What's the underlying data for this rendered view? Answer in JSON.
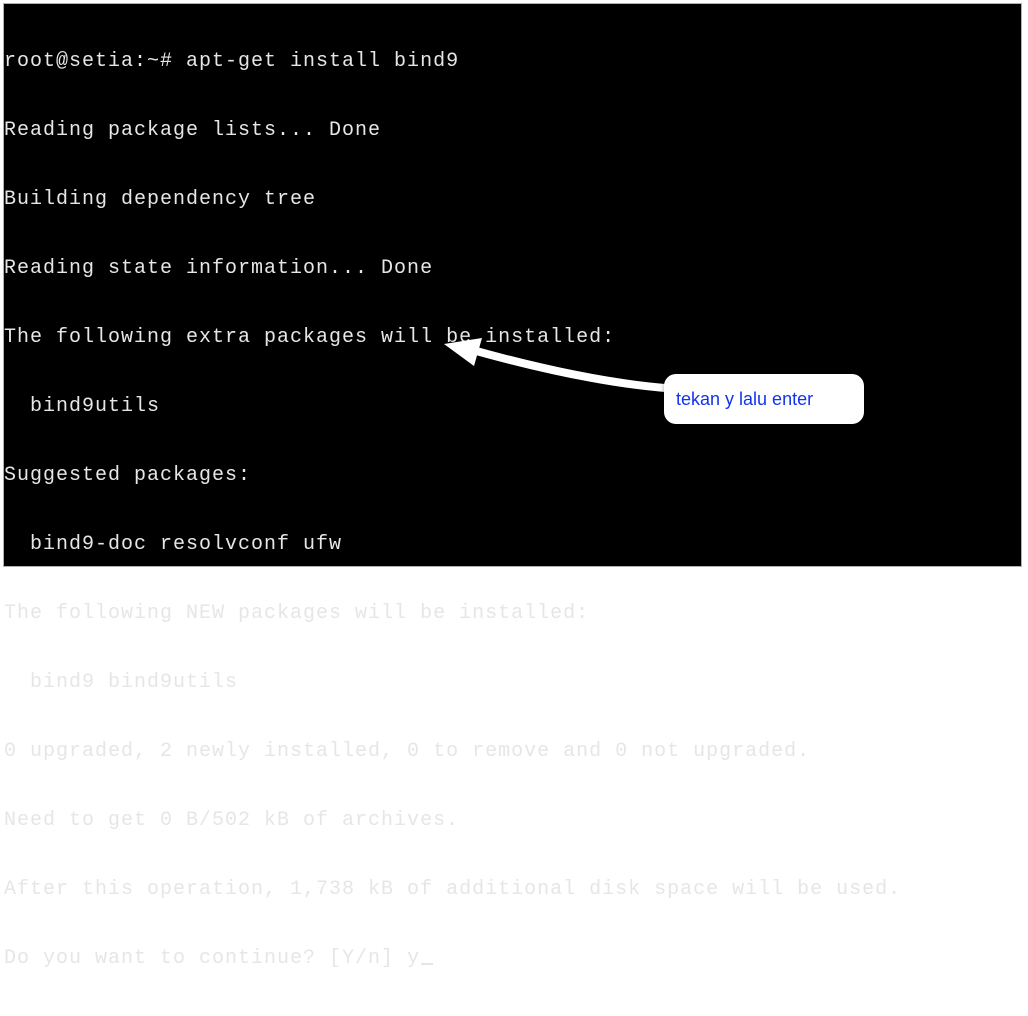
{
  "terminal": {
    "lines": [
      "root@setia:~# apt-get install bind9",
      "Reading package lists... Done",
      "Building dependency tree",
      "Reading state information... Done",
      "The following extra packages will be installed:",
      "  bind9utils",
      "Suggested packages:",
      "  bind9-doc resolvconf ufw",
      "The following NEW packages will be installed:",
      "  bind9 bind9utils",
      "0 upgraded, 2 newly installed, 0 to remove and 0 not upgraded.",
      "Need to get 0 B/502 kB of archives.",
      "After this operation, 1,738 kB of additional disk space will be used."
    ],
    "prompt_question": "Do you want to continue? [Y/n] ",
    "prompt_answer": "y"
  },
  "annotation": {
    "callout_text": "tekan y lalu enter"
  }
}
